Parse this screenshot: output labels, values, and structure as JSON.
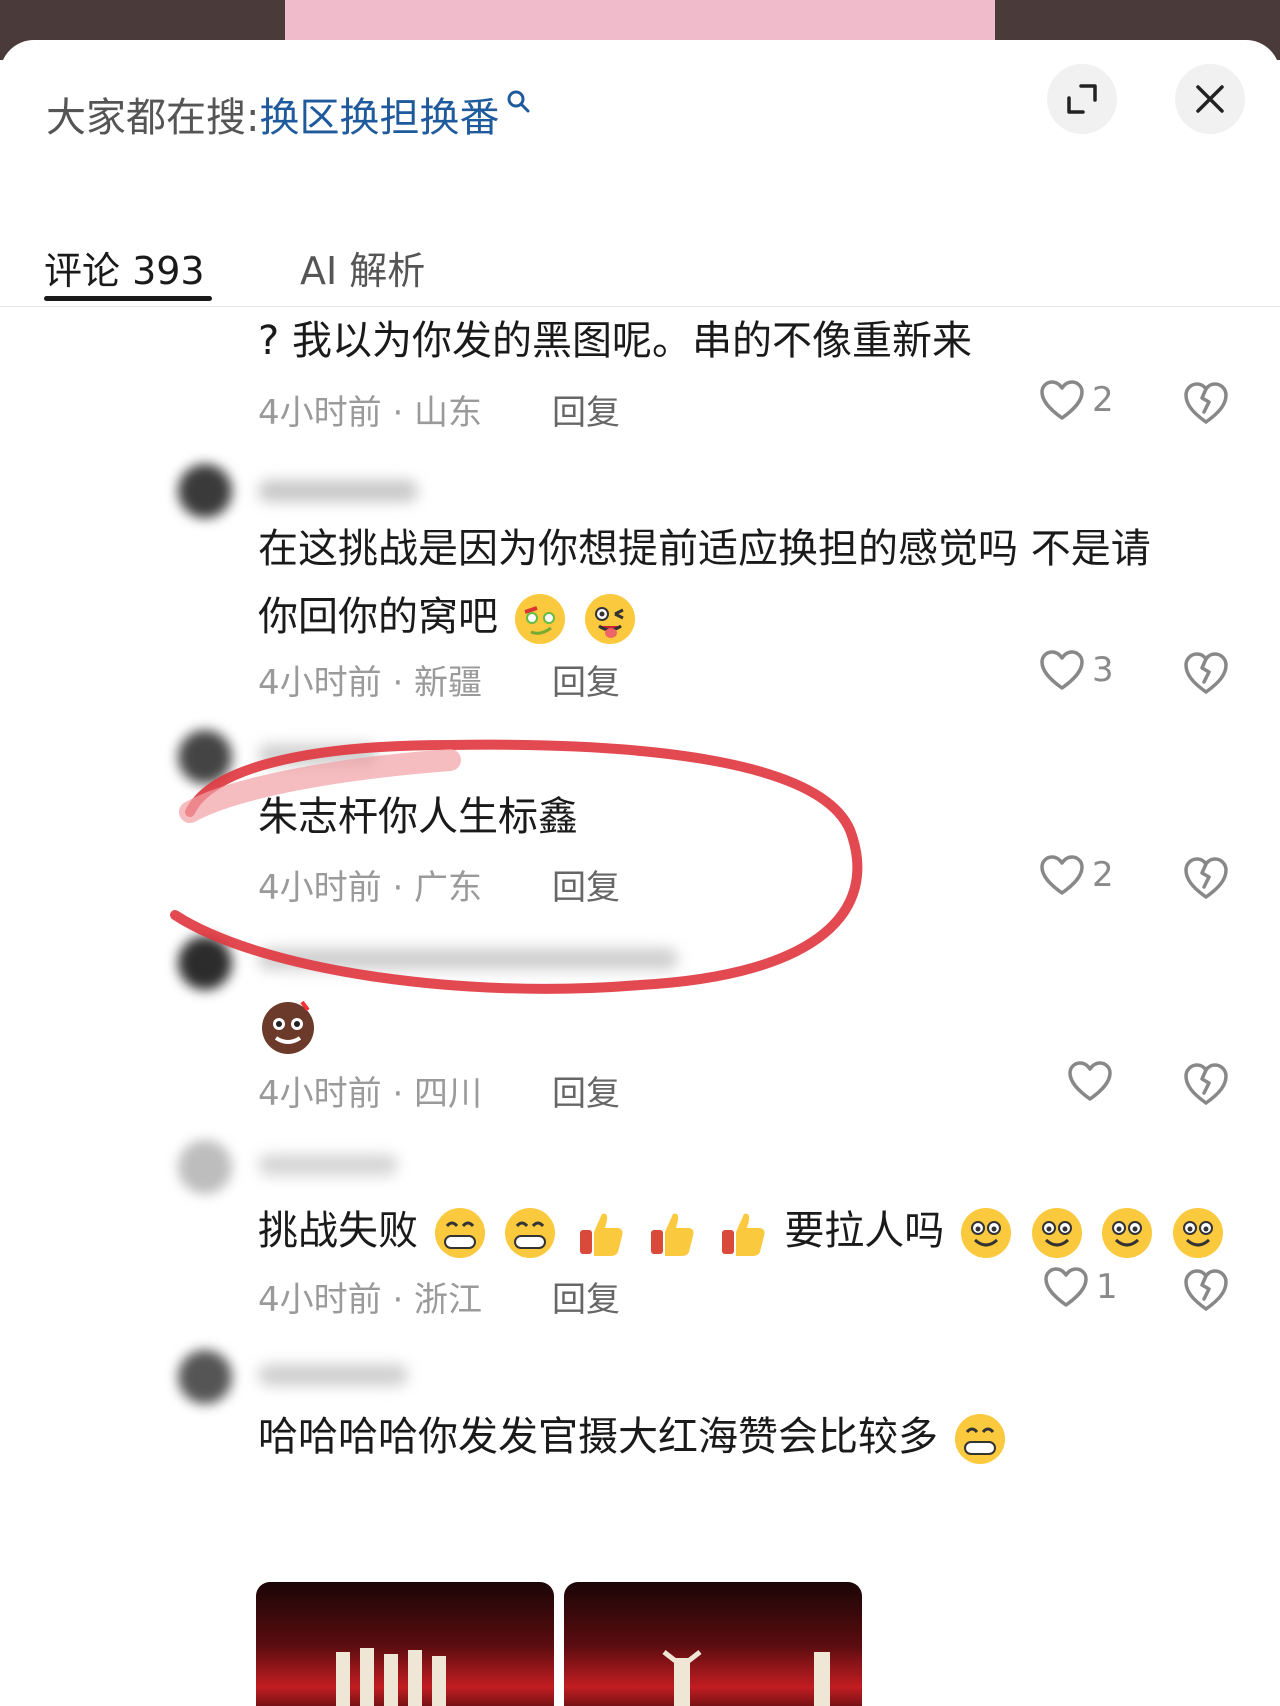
{
  "header": {
    "search_prefix": "大家都在搜:",
    "search_term": "换区换担换番"
  },
  "tabs": [
    {
      "label": "评论 393"
    },
    {
      "label": "AI 解析"
    }
  ],
  "comments": [
    {
      "text": "? 我以为你发的黑图呢。串的不像重新来",
      "time_loc": "4小时前 · 山东",
      "reply": "回复",
      "likes": "2"
    },
    {
      "text_line1": "在这挑战是因为你想提前适应换担的感觉吗 不是请",
      "text_line2": "你回你的窝吧",
      "time_loc": "4小时前 · 新疆",
      "reply": "回复",
      "likes": "3"
    },
    {
      "text": "朱志杆你人生标鑫",
      "time_loc": "4小时前 · 广东",
      "reply": "回复",
      "likes": "2"
    },
    {
      "text": "",
      "time_loc": "4小时前 · 四川",
      "reply": "回复",
      "likes": ""
    },
    {
      "text_a": "挑战失败",
      "text_b": "要拉人吗",
      "time_loc": "4小时前 · 浙江",
      "reply": "回复",
      "likes": "1"
    },
    {
      "text": "哈哈哈哈你发发官摄大红海赞会比较多"
    }
  ],
  "icons": [
    "search-mini-icon",
    "expand-icon",
    "close-icon",
    "heart-icon",
    "broken-heart-icon",
    "avatar"
  ],
  "colors": {
    "accent_link": "#1f5a9c",
    "annotation": "#e0353d",
    "tab_underline": "#1a1a1a"
  }
}
